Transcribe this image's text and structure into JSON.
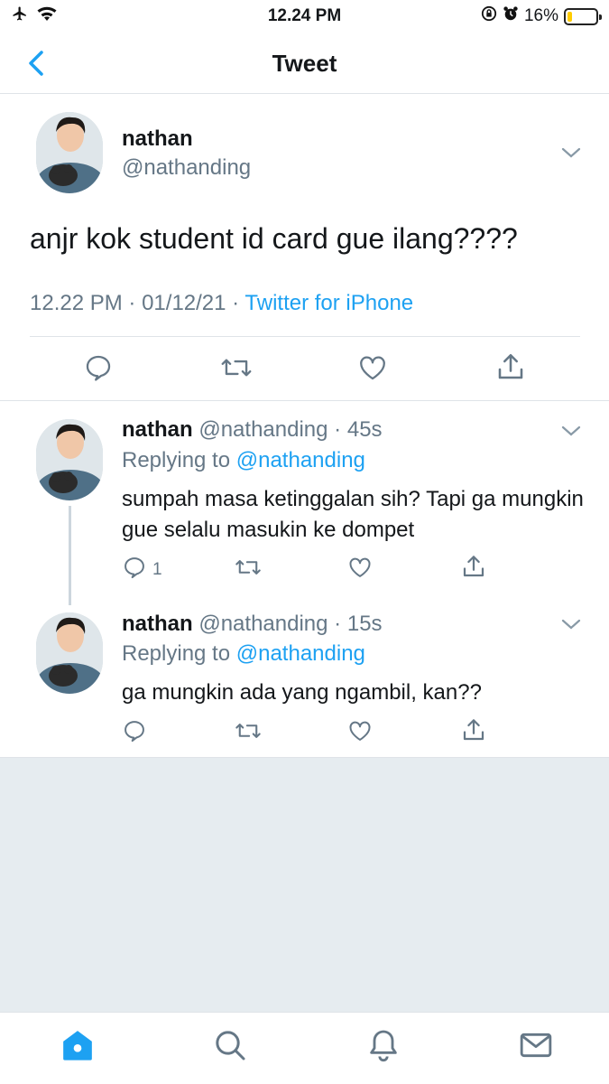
{
  "status_bar": {
    "time": "12.24 PM",
    "battery": "16%",
    "battery_level": 0.16
  },
  "nav": {
    "title": "Tweet"
  },
  "main_tweet": {
    "name": "nathan",
    "handle": "@nathanding",
    "text": "anjr kok student id card gue ilang????",
    "time": "12.22 PM",
    "date": "01/12/21",
    "source": "Twitter for iPhone"
  },
  "replies": [
    {
      "name": "nathan",
      "handle": "@nathanding",
      "age": "45s",
      "replying_label": "Replying to",
      "replying_to": "@nathanding",
      "text": "sumpah masa ketinggalan sih? Tapi ga mungkin gue selalu masukin ke dompet",
      "reply_count": "1"
    },
    {
      "name": "nathan",
      "handle": "@nathanding",
      "age": "15s",
      "replying_label": "Replying to",
      "replying_to": "@nathanding",
      "text": "ga mungkin ada yang ngambil, kan??",
      "reply_count": ""
    }
  ],
  "colors": {
    "accent": "#1da1f2",
    "secondary_text": "#657786",
    "divider": "#dfe3e8",
    "empty_bg": "#e6ecf0"
  },
  "icons": {
    "status": [
      "airplane-icon",
      "wifi-icon",
      "orientation-lock-icon",
      "alarm-icon",
      "battery-icon"
    ],
    "actions": [
      "reply-icon",
      "retweet-icon",
      "like-icon",
      "share-icon"
    ],
    "tabs": [
      "home-icon",
      "search-icon",
      "notifications-icon",
      "messages-icon"
    ]
  }
}
